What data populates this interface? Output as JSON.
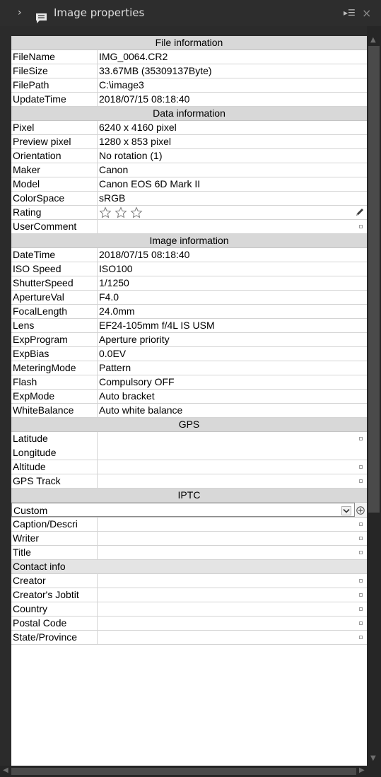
{
  "header": {
    "chevron_icon": "chevron-right-icon",
    "panel_icon": "speech-bubble-icon",
    "title": "Image properties",
    "options_icon": "▸☰",
    "close_icon": "×"
  },
  "file_information": {
    "heading": "File information",
    "rows": [
      {
        "key": "FileName",
        "value": "IMG_0064.CR2"
      },
      {
        "key": "FileSize",
        "value": "33.67MB (35309137Byte)"
      },
      {
        "key": "FilePath",
        "value": "C:\\image3"
      },
      {
        "key": "UpdateTime",
        "value": "2018/07/15 08:18:40"
      }
    ]
  },
  "data_information": {
    "heading": "Data information",
    "rows": [
      {
        "key": "Pixel",
        "value": "6240 x 4160 pixel"
      },
      {
        "key": "Preview pixel",
        "value": "1280 x 853 pixel"
      },
      {
        "key": "Orientation",
        "value": "No rotation (1)"
      },
      {
        "key": "Maker",
        "value": "Canon"
      },
      {
        "key": "Model",
        "value": "Canon EOS 6D Mark II"
      },
      {
        "key": "ColorSpace",
        "value": "sRGB"
      }
    ],
    "rating_label": "Rating",
    "rating_value": 0,
    "rating_max": 3,
    "user_comment_label": "UserComment",
    "user_comment_value": ""
  },
  "image_information": {
    "heading": "Image information",
    "rows": [
      {
        "key": "DateTime",
        "value": "2018/07/15 08:18:40"
      },
      {
        "key": "ISO Speed",
        "value": "ISO100"
      },
      {
        "key": "ShutterSpeed",
        "value": "1/1250"
      },
      {
        "key": "ApertureVal",
        "value": "F4.0"
      },
      {
        "key": "FocalLength",
        "value": "24.0mm"
      },
      {
        "key": "Lens",
        "value": "EF24-105mm f/4L IS USM"
      },
      {
        "key": "ExpProgram",
        "value": "Aperture priority"
      },
      {
        "key": "ExpBias",
        "value": "0.0EV"
      },
      {
        "key": "MeteringMode",
        "value": "Pattern"
      },
      {
        "key": "Flash",
        "value": "Compulsory OFF"
      },
      {
        "key": "ExpMode",
        "value": "Auto bracket"
      },
      {
        "key": "WhiteBalance",
        "value": "Auto white balance"
      }
    ]
  },
  "gps": {
    "heading": "GPS",
    "latitude_label": "Latitude",
    "longitude_label": "Longitude",
    "altitude_label": "Altitude",
    "track_label": "GPS Track"
  },
  "iptc": {
    "heading": "IPTC",
    "preset_selected": "Custom",
    "fields": [
      "Caption/Descri",
      "Writer",
      "Title"
    ],
    "contact_heading": "Contact info",
    "contact_fields": [
      "Creator",
      "Creator's Jobtit",
      "Country",
      "Postal Code",
      "State/Province"
    ]
  }
}
